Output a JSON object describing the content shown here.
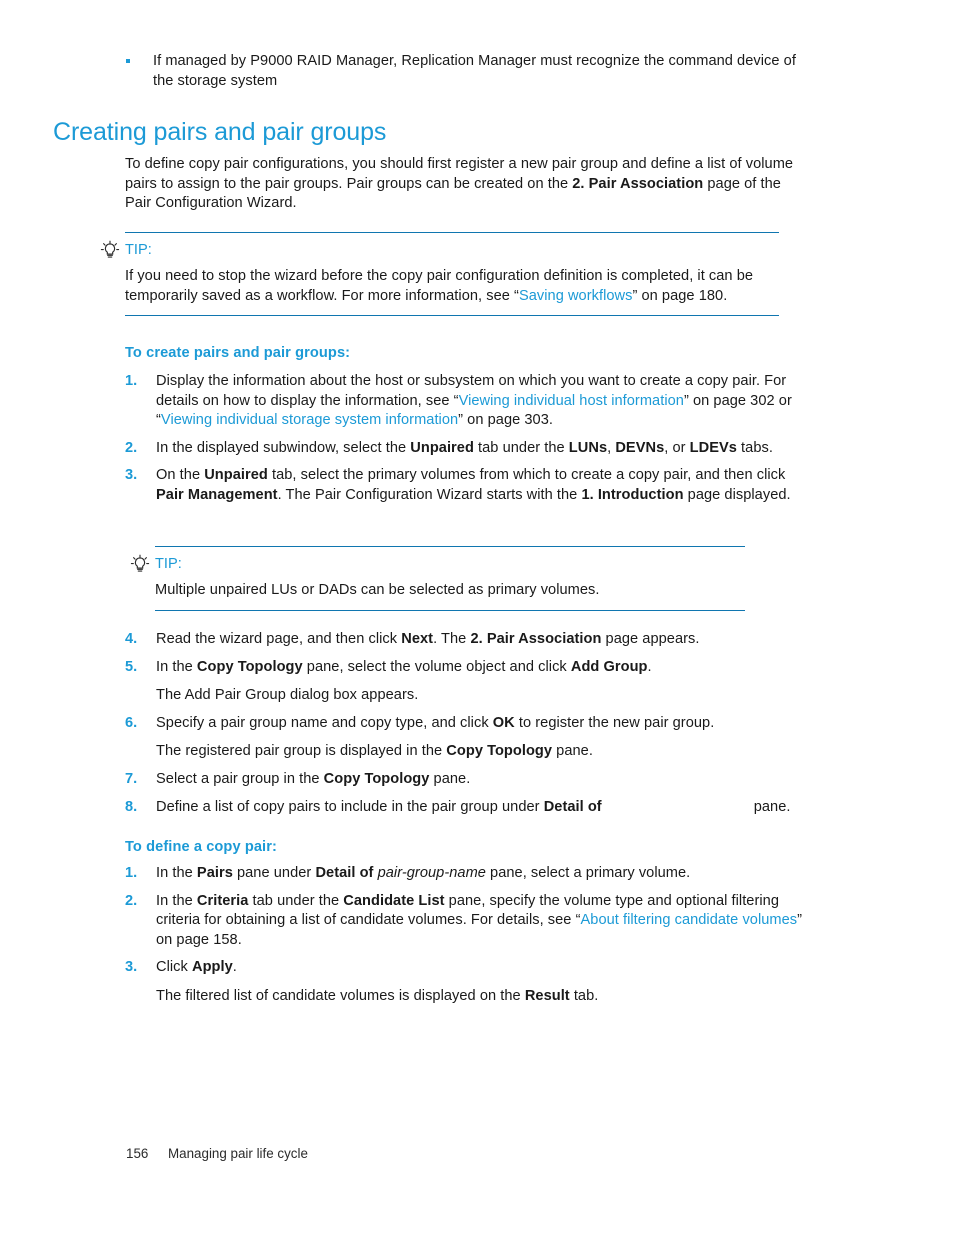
{
  "colors": {
    "brand_blue": "#1c9ad6",
    "rule_blue": "#1076b0",
    "body_text": "#1a1a1a"
  },
  "top_bullets": [
    {
      "text_parts": [
        {
          "t": "If managed by P9000 RAID Manager, Replication Manager must recognize the command device of the storage system",
          "style": "normal"
        }
      ]
    }
  ],
  "section": {
    "heading": "Creating pairs and pair groups",
    "intro_parts": [
      {
        "t": "To define copy pair configurations, you should first register a new pair group and define a list of volume pairs to assign to the pair groups. Pair groups can be created on the ",
        "style": "normal"
      },
      {
        "t": "2. Pair Association",
        "style": "bold"
      },
      {
        "t": " page of the Pair Configuration Wizard.",
        "style": "normal"
      }
    ]
  },
  "tip_1": {
    "icon": "lightbulb-icon",
    "label": "TIP:",
    "body_parts": [
      {
        "t": "If you need to stop the wizard before the copy pair configuration definition is completed, it can be temporarily saved as a workflow. For more information, see “",
        "style": "normal"
      },
      {
        "t": "Saving workflows",
        "style": "link"
      },
      {
        "t": "” on page 180.",
        "style": "normal"
      }
    ]
  },
  "tip_2": {
    "icon": "lightbulb-icon",
    "label": "TIP:",
    "body_parts": [
      {
        "t": "Multiple unpaired LUs or DADs can be selected as primary volumes.",
        "style": "normal"
      }
    ]
  },
  "procedure_1": {
    "heading": "To create pairs and pair groups:",
    "steps": [
      {
        "num": "1.",
        "parts": [
          {
            "t": "Display the information about the host or subsystem on which you want to create a copy pair. For details on how to display the information, see “",
            "style": "normal"
          },
          {
            "t": "Viewing individual host information",
            "style": "link"
          },
          {
            "t": "” on page 302 or “",
            "style": "normal"
          },
          {
            "t": "Viewing individual storage system information",
            "style": "link"
          },
          {
            "t": "” on page 303.",
            "style": "normal"
          }
        ]
      },
      {
        "num": "2.",
        "parts": [
          {
            "t": "In the displayed subwindow, select the ",
            "style": "normal"
          },
          {
            "t": "Unpaired",
            "style": "bold"
          },
          {
            "t": " tab under the ",
            "style": "normal"
          },
          {
            "t": "LUNs",
            "style": "bold"
          },
          {
            "t": ", ",
            "style": "normal"
          },
          {
            "t": "DEVNs",
            "style": "bold"
          },
          {
            "t": ", or ",
            "style": "normal"
          },
          {
            "t": "LDEVs",
            "style": "bold"
          },
          {
            "t": " tabs.",
            "style": "normal"
          }
        ]
      },
      {
        "num": "3.",
        "parts": [
          {
            "t": "On the ",
            "style": "normal"
          },
          {
            "t": "Unpaired",
            "style": "bold"
          },
          {
            "t": " tab, select the primary volumes from which to create a copy pair, and then click ",
            "style": "normal"
          },
          {
            "t": "Pair Management",
            "style": "bold"
          },
          {
            "t": ". The Pair Configuration Wizard starts with the ",
            "style": "normal"
          },
          {
            "t": "1. Introduction",
            "style": "bold"
          },
          {
            "t": " page displayed.",
            "style": "normal"
          }
        ]
      }
    ],
    "steps_cont": [
      {
        "num": "4.",
        "parts": [
          {
            "t": "Read the wizard page, and then click ",
            "style": "normal"
          },
          {
            "t": "Next",
            "style": "bold"
          },
          {
            "t": ". The ",
            "style": "normal"
          },
          {
            "t": "2. Pair Association",
            "style": "bold"
          },
          {
            "t": " page appears.",
            "style": "normal"
          }
        ]
      },
      {
        "num": "5.",
        "parts": [
          {
            "t": "In the ",
            "style": "normal"
          },
          {
            "t": "Copy Topology",
            "style": "bold"
          },
          {
            "t": " pane, select the volume object and click ",
            "style": "normal"
          },
          {
            "t": "Add Group",
            "style": "bold"
          },
          {
            "t": ".",
            "style": "normal"
          }
        ],
        "sub_parts": [
          {
            "t": "The Add Pair Group dialog box appears.",
            "style": "normal"
          }
        ]
      },
      {
        "num": "6.",
        "parts": [
          {
            "t": "Specify a pair group name and copy type, and click ",
            "style": "normal"
          },
          {
            "t": "OK",
            "style": "bold"
          },
          {
            "t": " to register the new pair group.",
            "style": "normal"
          }
        ],
        "sub_parts": [
          {
            "t": "The registered pair group is displayed in the ",
            "style": "normal"
          },
          {
            "t": "Copy Topology",
            "style": "bold"
          },
          {
            "t": " pane.",
            "style": "normal"
          }
        ]
      },
      {
        "num": "7.",
        "parts": [
          {
            "t": "Select a pair group in the ",
            "style": "normal"
          },
          {
            "t": "Copy Topology",
            "style": "bold"
          },
          {
            "t": " pane.",
            "style": "normal"
          }
        ]
      },
      {
        "num": "8.",
        "parts": [
          {
            "t": "Define a list of copy pairs to include in the pair group under ",
            "style": "normal"
          },
          {
            "t": "Detail of",
            "style": "bold"
          },
          {
            "t": "",
            "style": "gap"
          },
          {
            "t": "pane.",
            "style": "normal"
          }
        ]
      }
    ]
  },
  "procedure_2": {
    "heading": "To define a copy pair:",
    "steps": [
      {
        "num": "1.",
        "parts": [
          {
            "t": "In the ",
            "style": "normal"
          },
          {
            "t": "Pairs",
            "style": "bold"
          },
          {
            "t": " pane under ",
            "style": "normal"
          },
          {
            "t": "Detail of",
            "style": "bold"
          },
          {
            "t": " ",
            "style": "normal"
          },
          {
            "t": "pair-group-name",
            "style": "italic"
          },
          {
            "t": " pane, select a primary volume.",
            "style": "normal"
          }
        ]
      },
      {
        "num": "2.",
        "parts": [
          {
            "t": "In the ",
            "style": "normal"
          },
          {
            "t": "Criteria",
            "style": "bold"
          },
          {
            "t": " tab under the ",
            "style": "normal"
          },
          {
            "t": "Candidate List",
            "style": "bold"
          },
          {
            "t": " pane, specify the volume type and optional filtering criteria for obtaining a list of candidate volumes. For details, see “",
            "style": "normal"
          },
          {
            "t": "About filtering candidate volumes",
            "style": "link"
          },
          {
            "t": "” on page 158.",
            "style": "normal"
          }
        ]
      },
      {
        "num": "3.",
        "parts": [
          {
            "t": "Click ",
            "style": "normal"
          },
          {
            "t": "Apply",
            "style": "bold"
          },
          {
            "t": ".",
            "style": "normal"
          }
        ],
        "sub_parts": [
          {
            "t": "The filtered list of candidate volumes is displayed on the ",
            "style": "normal"
          },
          {
            "t": "Result",
            "style": "bold"
          },
          {
            "t": " tab.",
            "style": "normal"
          }
        ]
      }
    ]
  },
  "footer": {
    "page_number": "156",
    "chapter_title": "Managing pair life cycle"
  }
}
